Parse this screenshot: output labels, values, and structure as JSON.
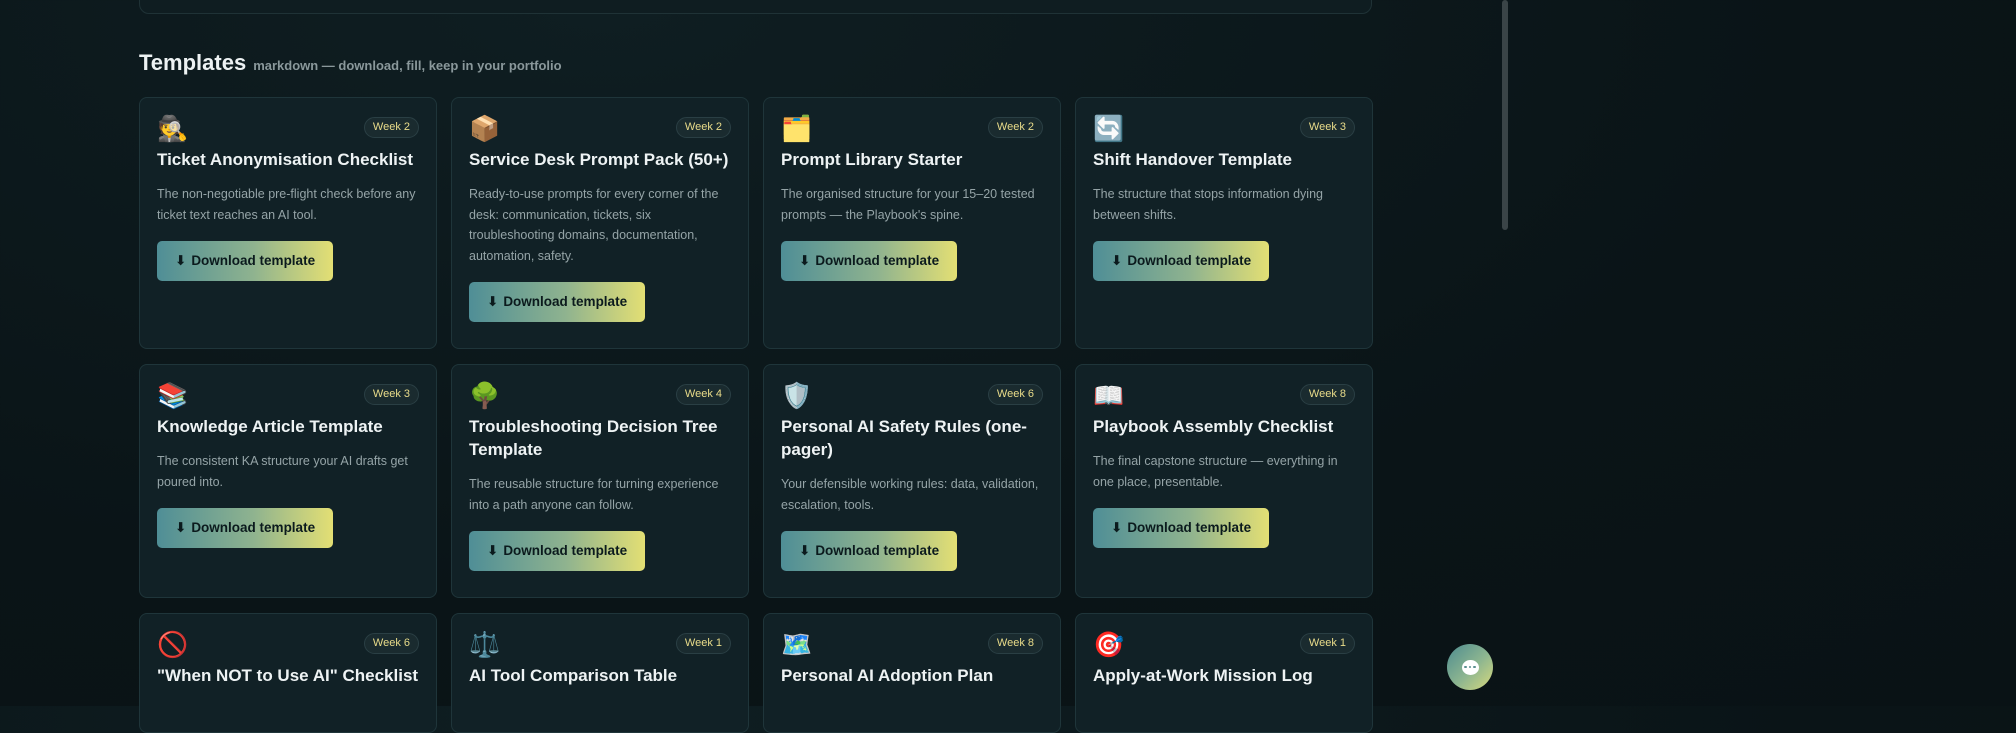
{
  "section": {
    "title": "Templates",
    "subtitle": "markdown — download, fill, keep in your portfolio"
  },
  "download_label": "Download template",
  "download_icon": "⬇",
  "cards": [
    {
      "icon": "🕵️",
      "icon_name": "detective-icon",
      "week": "Week 2",
      "title": "Ticket Anonymisation Checklist",
      "desc": "The non-negotiable pre-flight check before any ticket text reaches an AI tool."
    },
    {
      "icon": "📦",
      "icon_name": "package-icon",
      "week": "Week 2",
      "title": "Service Desk Prompt Pack (50+)",
      "desc": "Ready-to-use prompts for every corner of the desk: communication, tickets, six troubleshooting domains, documentation, automation, safety."
    },
    {
      "icon": "🗂️",
      "icon_name": "card-index-dividers-icon",
      "week": "Week 2",
      "title": "Prompt Library Starter",
      "desc": "The organised structure for your 15–20 tested prompts — the Playbook's spine."
    },
    {
      "icon": "🔄",
      "icon_name": "refresh-arrows-icon",
      "week": "Week 3",
      "title": "Shift Handover Template",
      "desc": "The structure that stops information dying between shifts."
    },
    {
      "icon": "📚",
      "icon_name": "books-icon",
      "week": "Week 3",
      "title": "Knowledge Article Template",
      "desc": "The consistent KA structure your AI drafts get poured into."
    },
    {
      "icon": "🌳",
      "icon_name": "tree-icon",
      "week": "Week 4",
      "title": "Troubleshooting Decision Tree Template",
      "desc": "The reusable structure for turning experience into a path anyone can follow."
    },
    {
      "icon": "🛡️",
      "icon_name": "shield-icon",
      "week": "Week 6",
      "title": "Personal AI Safety Rules (one-pager)",
      "desc": "Your defensible working rules: data, validation, escalation, tools."
    },
    {
      "icon": "📖",
      "icon_name": "open-book-icon",
      "week": "Week 8",
      "title": "Playbook Assembly Checklist",
      "desc": "The final capstone structure — everything in one place, presentable."
    },
    {
      "icon": "🚫",
      "icon_name": "prohibited-icon",
      "week": "Week 6",
      "title": "\"When NOT to Use AI\" Checklist",
      "desc": ""
    },
    {
      "icon": "⚖️",
      "icon_name": "balance-scale-icon",
      "week": "Week 1",
      "title": "AI Tool Comparison Table",
      "desc": ""
    },
    {
      "icon": "🗺️",
      "icon_name": "map-icon",
      "week": "Week 8",
      "title": "Personal AI Adoption Plan",
      "desc": ""
    },
    {
      "icon": "🎯",
      "icon_name": "target-icon",
      "week": "Week 1",
      "title": "Apply-at-Work Mission Log",
      "desc": ""
    }
  ],
  "colors": {
    "accent_gradient_start": "#4f8e96",
    "accent_gradient_end": "#e3df74",
    "badge_text": "#e9dc8a",
    "background": "#0b1619",
    "card_background": "#112126"
  }
}
